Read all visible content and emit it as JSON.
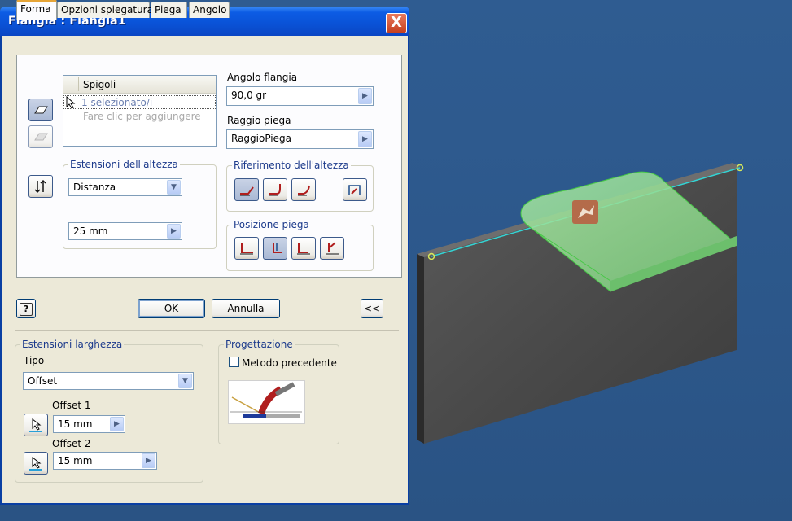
{
  "dialog": {
    "title": "Flangia : Flangia1",
    "close_label": "X"
  },
  "tabs": [
    {
      "label": "Forma",
      "active": true
    },
    {
      "label": "Opzioni spiegatura",
      "active": false
    },
    {
      "label": "Piega",
      "active": false
    },
    {
      "label": "Angolo",
      "active": false
    }
  ],
  "edges": {
    "header": "Spigoli",
    "selected": "1 selezionato/i",
    "hint": "Fare clic per aggiungere"
  },
  "flange_angle": {
    "label": "Angolo flangia",
    "value": "90,0 gr"
  },
  "bend_radius": {
    "label": "Raggio piega",
    "value": "RaggioPiega"
  },
  "height_extents": {
    "title": "Estensioni dell'altezza",
    "type_value": "Distanza",
    "distance_value": "25 mm"
  },
  "height_reference": {
    "title": "Riferimento dell'altezza"
  },
  "bend_position": {
    "title": "Posizione piega"
  },
  "buttons": {
    "help": "?",
    "ok": "OK",
    "cancel": "Annulla",
    "collapse": "<<"
  },
  "width_extents": {
    "title": "Estensioni larghezza",
    "type_label": "Tipo",
    "type_value": "Offset",
    "offset1_label": "Offset 1",
    "offset1_value": "15 mm",
    "offset2_label": "Offset 2",
    "offset2_value": "15 mm"
  },
  "design": {
    "title": "Progettazione",
    "legacy_method_label": "Metodo precedente",
    "legacy_method_checked": false
  },
  "colors": {
    "title_bar": "#0a52d6",
    "viewport_bg": "#2c578a",
    "flange_preview": "#8fe08f",
    "close_button": "#c6401f"
  }
}
